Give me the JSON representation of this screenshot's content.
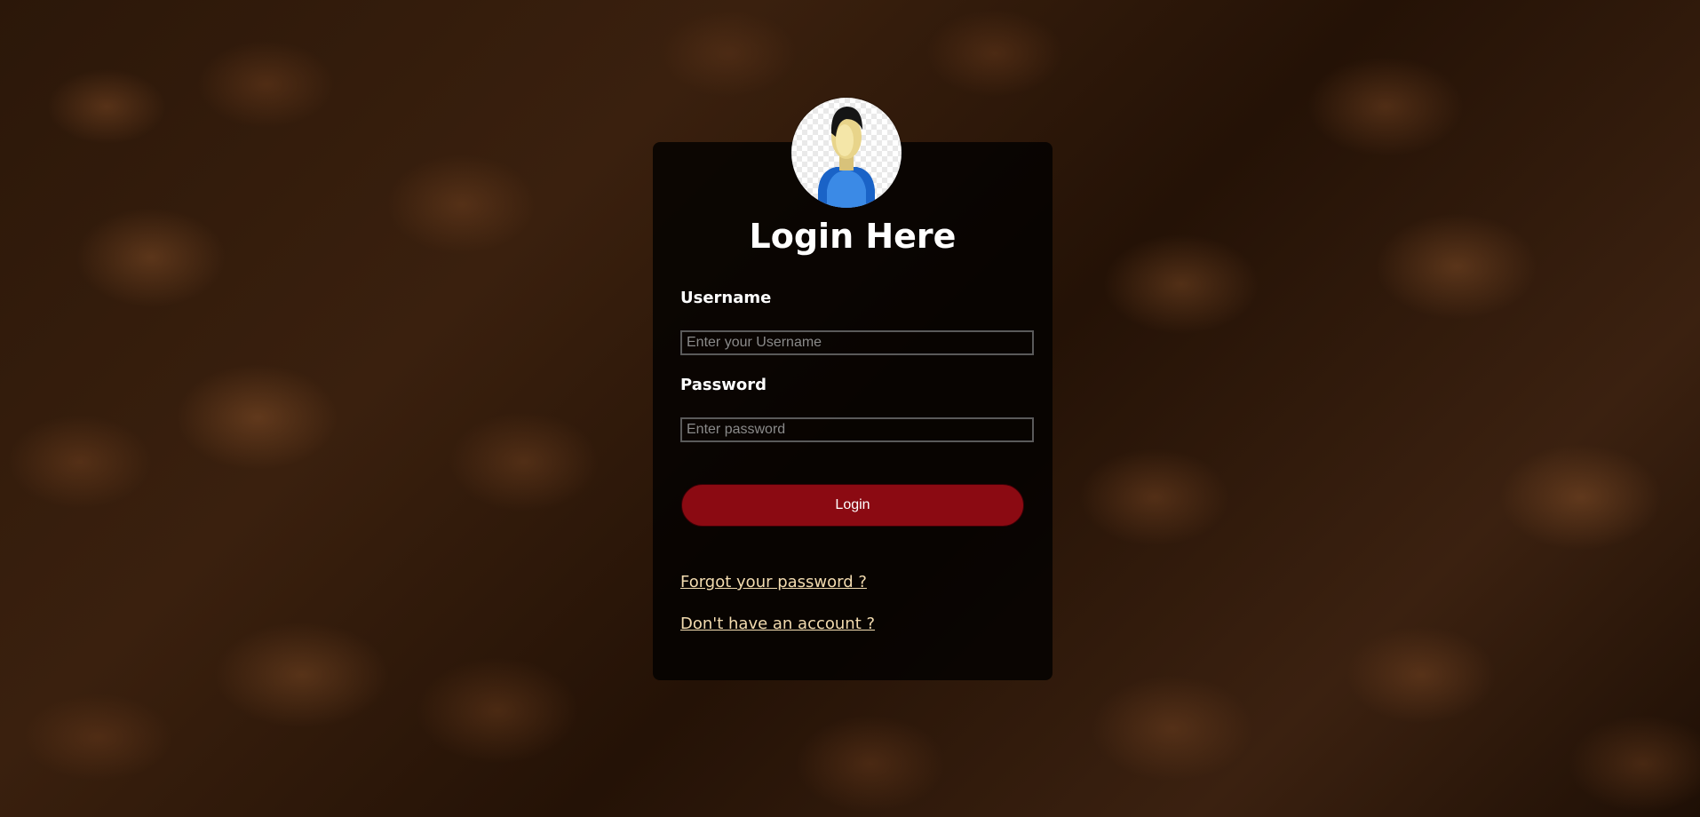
{
  "login": {
    "title": "Login Here",
    "username_label": "Username",
    "username_placeholder": "Enter your Username",
    "password_label": "Password",
    "password_placeholder": "Enter password",
    "login_button": "Login",
    "forgot_link": "Forgot your password ?",
    "signup_link": "Don't have an account ?"
  },
  "icons": {
    "avatar": "user-avatar-icon"
  },
  "colors": {
    "button_bg": "#8b0a12",
    "link": "#f3dcb0",
    "card_bg": "rgba(0,0,0,0.78)"
  }
}
